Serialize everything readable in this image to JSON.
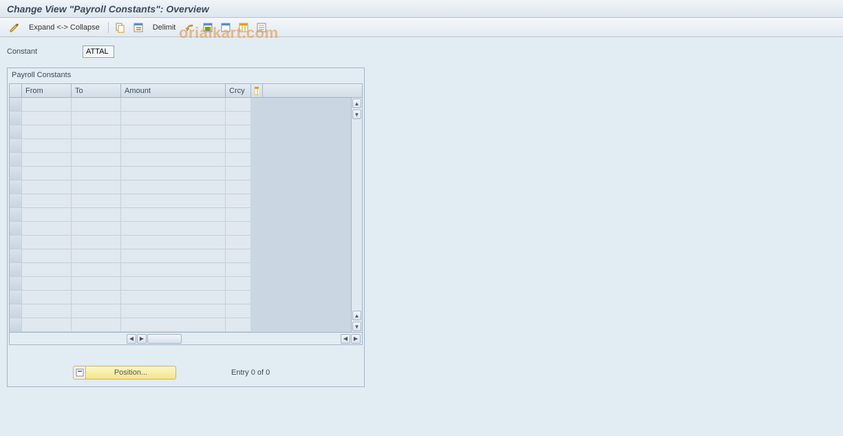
{
  "title": "Change View \"Payroll Constants\": Overview",
  "toolbar": {
    "expand_collapse": "Expand <-> Collapse",
    "delimit": "Delimit"
  },
  "form": {
    "constant_label": "Constant",
    "constant_value": "ATTAL"
  },
  "group": {
    "title": "Payroll Constants",
    "columns": {
      "from": "From",
      "to": "To",
      "amount": "Amount",
      "crcy": "Crcy"
    }
  },
  "footer": {
    "position": "Position...",
    "entry": "Entry 0 of 0"
  },
  "watermark": "orialkart.com"
}
